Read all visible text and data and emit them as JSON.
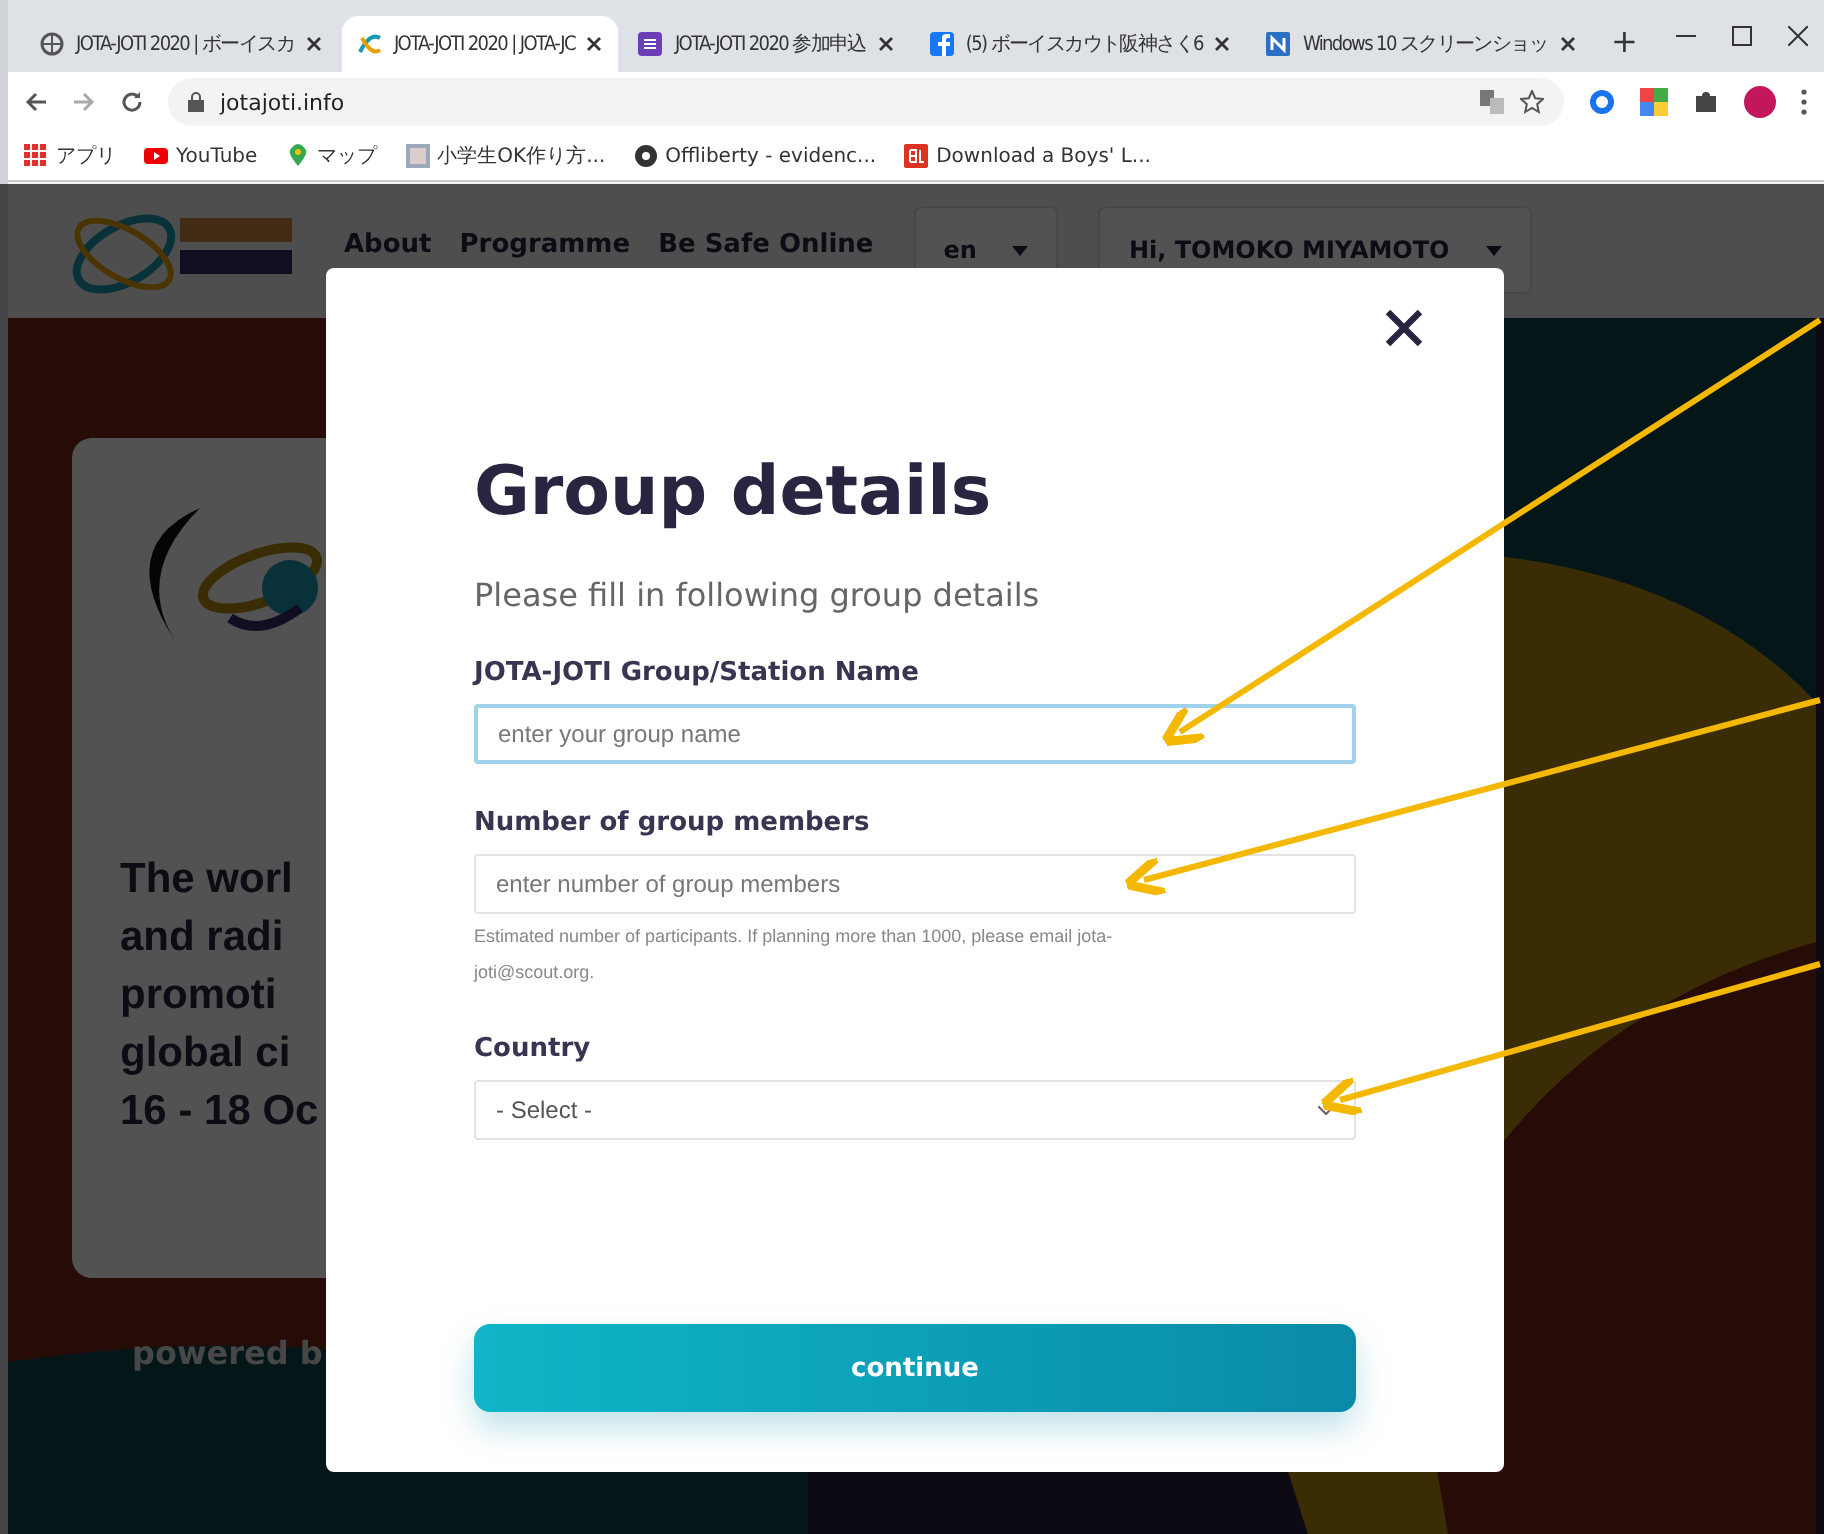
{
  "browser": {
    "tabs": [
      {
        "title": "JOTA-JOTI 2020 | ボーイスカ",
        "selected": false
      },
      {
        "title": "JOTA-JOTI 2020 | JOTA-JC",
        "selected": true
      },
      {
        "title": "JOTA-JOTI 2020 参加申込",
        "selected": false
      },
      {
        "title": "(5) ボーイスカウト阪神さく6",
        "selected": false
      },
      {
        "title": "Windows 10 スクリーンショッ",
        "selected": false
      }
    ],
    "new_tab": "+",
    "url": "jotajoti.info",
    "bookmarks": [
      {
        "label": "アプリ"
      },
      {
        "label": "YouTube"
      },
      {
        "label": "マップ"
      },
      {
        "label": "小学生OK作り方..."
      },
      {
        "label": "Offliberty - evidenc..."
      },
      {
        "label": "Download a Boys' L..."
      }
    ]
  },
  "site": {
    "nav": [
      "About",
      "Programme",
      "Be Safe Online"
    ],
    "language": "en",
    "user": "Hi, TOMOKO MIYAMOTO",
    "hero_lines": [
      "The worl",
      "and radi",
      "promoti",
      "global ci",
      "16 - 18 Oc"
    ],
    "footer": "powered b"
  },
  "modal": {
    "title": "Group details",
    "subtitle": "Please fill in following group details",
    "fields": [
      {
        "kind": "input",
        "label": "JOTA-JOTI Group/Station Name",
        "placeholder": "enter your group name",
        "focused": true
      },
      {
        "kind": "input",
        "label": "Number of group members",
        "placeholder": "enter number of group members",
        "help": "Estimated number of participants. If planning more than 1000, please email jota-joti@scout.org.",
        "focused": false
      },
      {
        "kind": "select",
        "label": "Country",
        "value": "- Select -",
        "focused": false
      }
    ],
    "button": "continue"
  }
}
